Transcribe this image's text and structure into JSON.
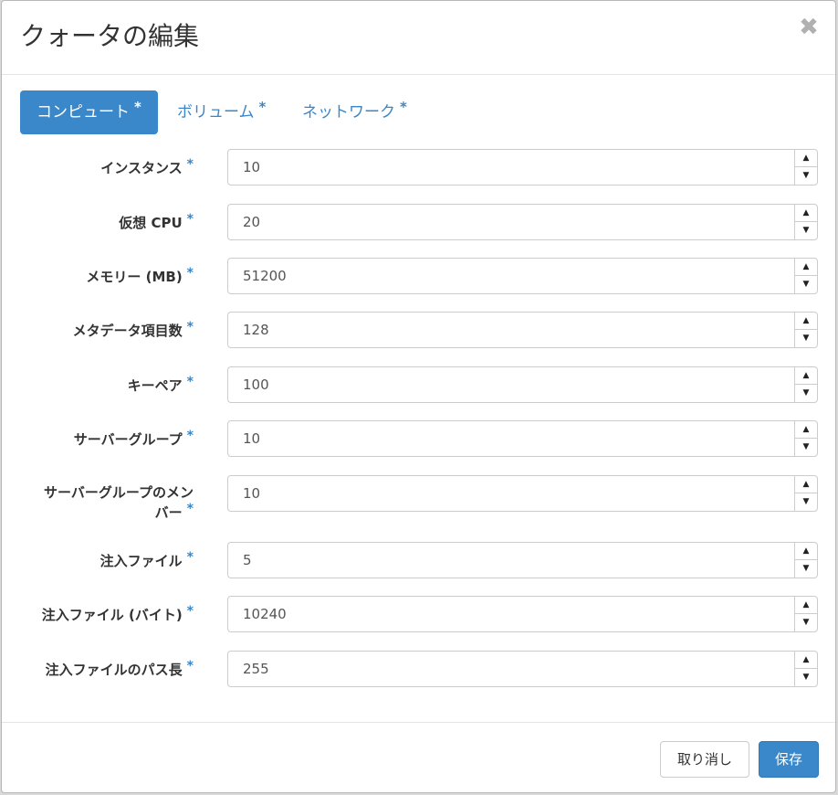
{
  "modal": {
    "title": "クォータの編集",
    "close_label": "✖"
  },
  "tabs": [
    {
      "label": "コンピュート",
      "required": "*",
      "active": true
    },
    {
      "label": "ボリューム",
      "required": "*",
      "active": false
    },
    {
      "label": "ネットワーク",
      "required": "*",
      "active": false
    }
  ],
  "fields": [
    {
      "label": "インスタンス",
      "required": "*",
      "value": "10"
    },
    {
      "label": "仮想 CPU",
      "required": "*",
      "value": "20"
    },
    {
      "label": "メモリー (MB)",
      "required": "*",
      "value": "51200"
    },
    {
      "label": "メタデータ項目数",
      "required": "*",
      "value": "128"
    },
    {
      "label": "キーペア",
      "required": "*",
      "value": "100"
    },
    {
      "label": "サーバーグループ",
      "required": "*",
      "value": "10"
    },
    {
      "label_line1": "サーバーグループのメン",
      "label_line2": "バー",
      "required": "*",
      "value": "10"
    },
    {
      "label": "注入ファイル",
      "required": "*",
      "value": "5"
    },
    {
      "label": "注入ファイル (バイト)",
      "required": "*",
      "value": "10240"
    },
    {
      "label": "注入ファイルのパス長",
      "required": "*",
      "value": "255"
    }
  ],
  "spinner": {
    "up_icon": "▲",
    "down_icon": "▼"
  },
  "footer": {
    "cancel_label": "取り消し",
    "save_label": "保存"
  },
  "colors": {
    "primary": "#3a87c9",
    "required_marker": "#3a86c8"
  }
}
